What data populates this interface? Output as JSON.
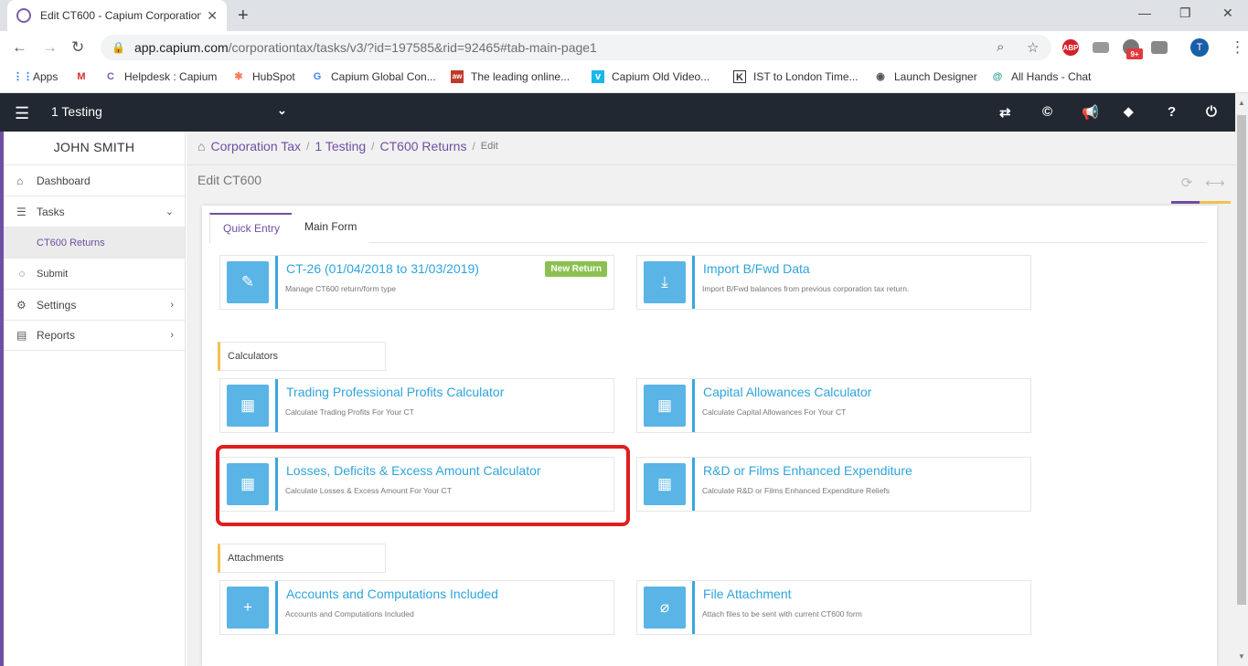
{
  "browser": {
    "tab_title": "Edit CT600 - Capium Corporation",
    "url_host": "app.capium.com",
    "url_path": "/corporationtax/tasks/v3/?id=197585&rid=92465#tab-main-page1",
    "profile_initial": "T",
    "ext_badge": "9+",
    "bookmarks": [
      {
        "label": "Apps",
        "icon": "apps-grid-icon"
      },
      {
        "label": "",
        "icon": "gmail-icon"
      },
      {
        "label": "Helpdesk : Capium",
        "icon": "capium-icon"
      },
      {
        "label": "HubSpot",
        "icon": "hubspot-icon"
      },
      {
        "label": "Capium Global Con...",
        "icon": "google-icon"
      },
      {
        "label": "The leading online...",
        "icon": "site-icon"
      },
      {
        "label": "Capium Old Video...",
        "icon": "vimeo-icon"
      },
      {
        "label": "IST to London Time...",
        "icon": "clock-icon"
      },
      {
        "label": "Launch Designer",
        "icon": "globe-icon"
      },
      {
        "label": "All Hands - Chat",
        "icon": "chat-icon"
      }
    ]
  },
  "topbar": {
    "client": "1 Testing"
  },
  "sidebar": {
    "user": "JOHN SMITH",
    "items": [
      {
        "label": "Dashboard"
      },
      {
        "label": "Tasks"
      },
      {
        "label": "CT600 Returns"
      },
      {
        "label": "Submit"
      },
      {
        "label": "Settings"
      },
      {
        "label": "Reports"
      }
    ]
  },
  "breadcrumb": {
    "items": [
      "Corporation Tax",
      "1 Testing",
      "CT600 Returns"
    ],
    "current": "Edit"
  },
  "page": {
    "title": "Edit CT600"
  },
  "tabs": [
    "Quick Entry",
    "Main Form"
  ],
  "cards": {
    "return": {
      "title": "CT-26 (01/04/2018 to 31/03/2019)",
      "sub": "Manage CT600 return/form type",
      "badge": "New Return"
    },
    "import": {
      "title": "Import B/Fwd Data",
      "sub": "Import B/Fwd balances from previous corporation tax return."
    },
    "trading": {
      "title": "Trading Professional Profits Calculator",
      "sub": "Calculate Trading Profits For Your CT"
    },
    "capital": {
      "title": "Capital Allowances Calculator",
      "sub": "Calculate Capital Allowances For Your CT"
    },
    "losses": {
      "title": "Losses, Deficits & Excess Amount Calculator",
      "sub": "Calculate Losses & Excess Amount For Your CT"
    },
    "rnd": {
      "title": "R&D or Films Enhanced Expenditure",
      "sub": "Calculate R&D or Films Enhanced Expenditure Reliefs"
    },
    "accounts": {
      "title": "Accounts and Computations Included",
      "sub": "Accounts and Computations Included"
    },
    "file": {
      "title": "File Attachment",
      "sub": "Attach files to be sent with current CT600 form"
    }
  },
  "sections": {
    "calculators": "Calculators",
    "attachments": "Attachments"
  },
  "colors": {
    "accent": "#6f4fa3",
    "card_blue": "#5ab4e5",
    "highlight": "#e01e1e",
    "badge": "#8cc152"
  }
}
